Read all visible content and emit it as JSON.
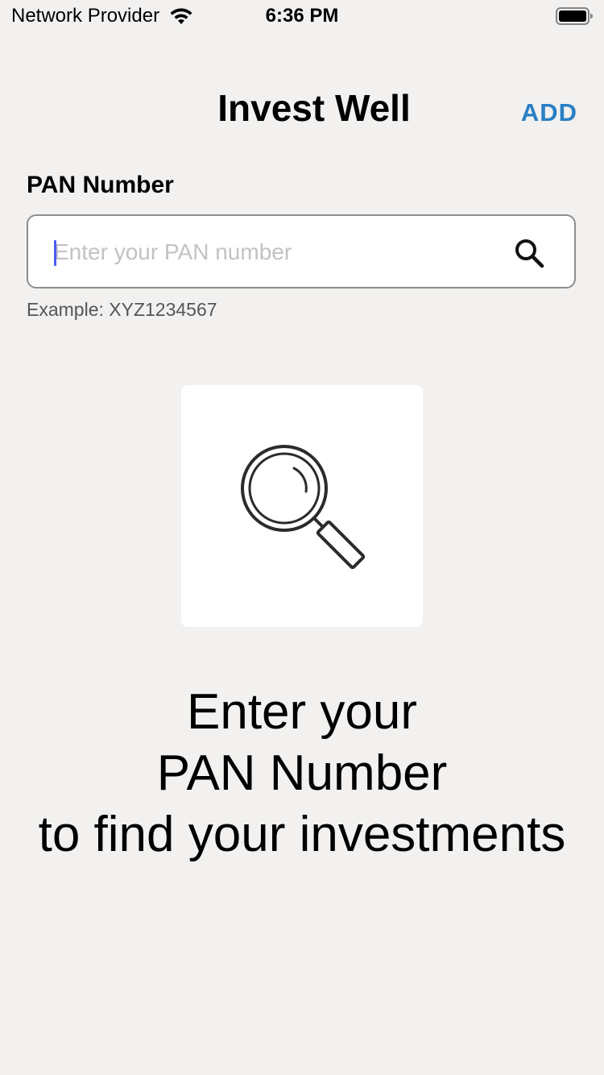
{
  "status_bar": {
    "carrier": "Network Provider",
    "time": "6:36 PM",
    "icons": [
      "wifi-icon",
      "battery-icon"
    ]
  },
  "nav": {
    "title": "Invest Well",
    "add_label": "ADD"
  },
  "pan_field": {
    "label": "PAN Number",
    "value": "",
    "placeholder": "Enter your PAN number",
    "hint": "Example: XYZ1234567",
    "icon": "search-icon"
  },
  "empty_state": {
    "icon": "magnifying-glass-icon",
    "line1": "Enter your",
    "line2": "PAN Number",
    "line3": "to find your investments"
  },
  "colors": {
    "background": "#f2f1f0",
    "accent": "#2a7fc4",
    "caret": "#4a5cf0",
    "field_border": "#8d8d8d"
  }
}
